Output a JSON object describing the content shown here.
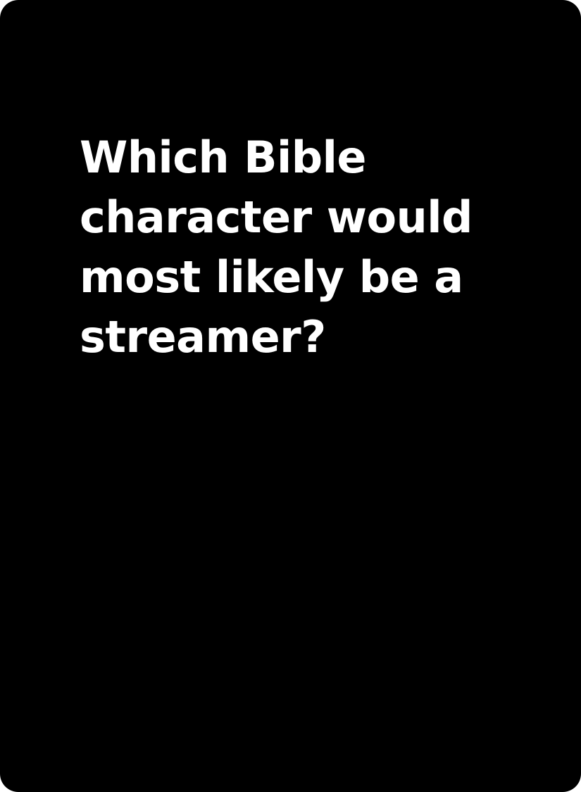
{
  "card": {
    "background_color": "#000000",
    "text_color": "#ffffff",
    "prompt_lines": [
      "Which Bible",
      "character would",
      "most likely be a",
      "streamer?"
    ]
  }
}
